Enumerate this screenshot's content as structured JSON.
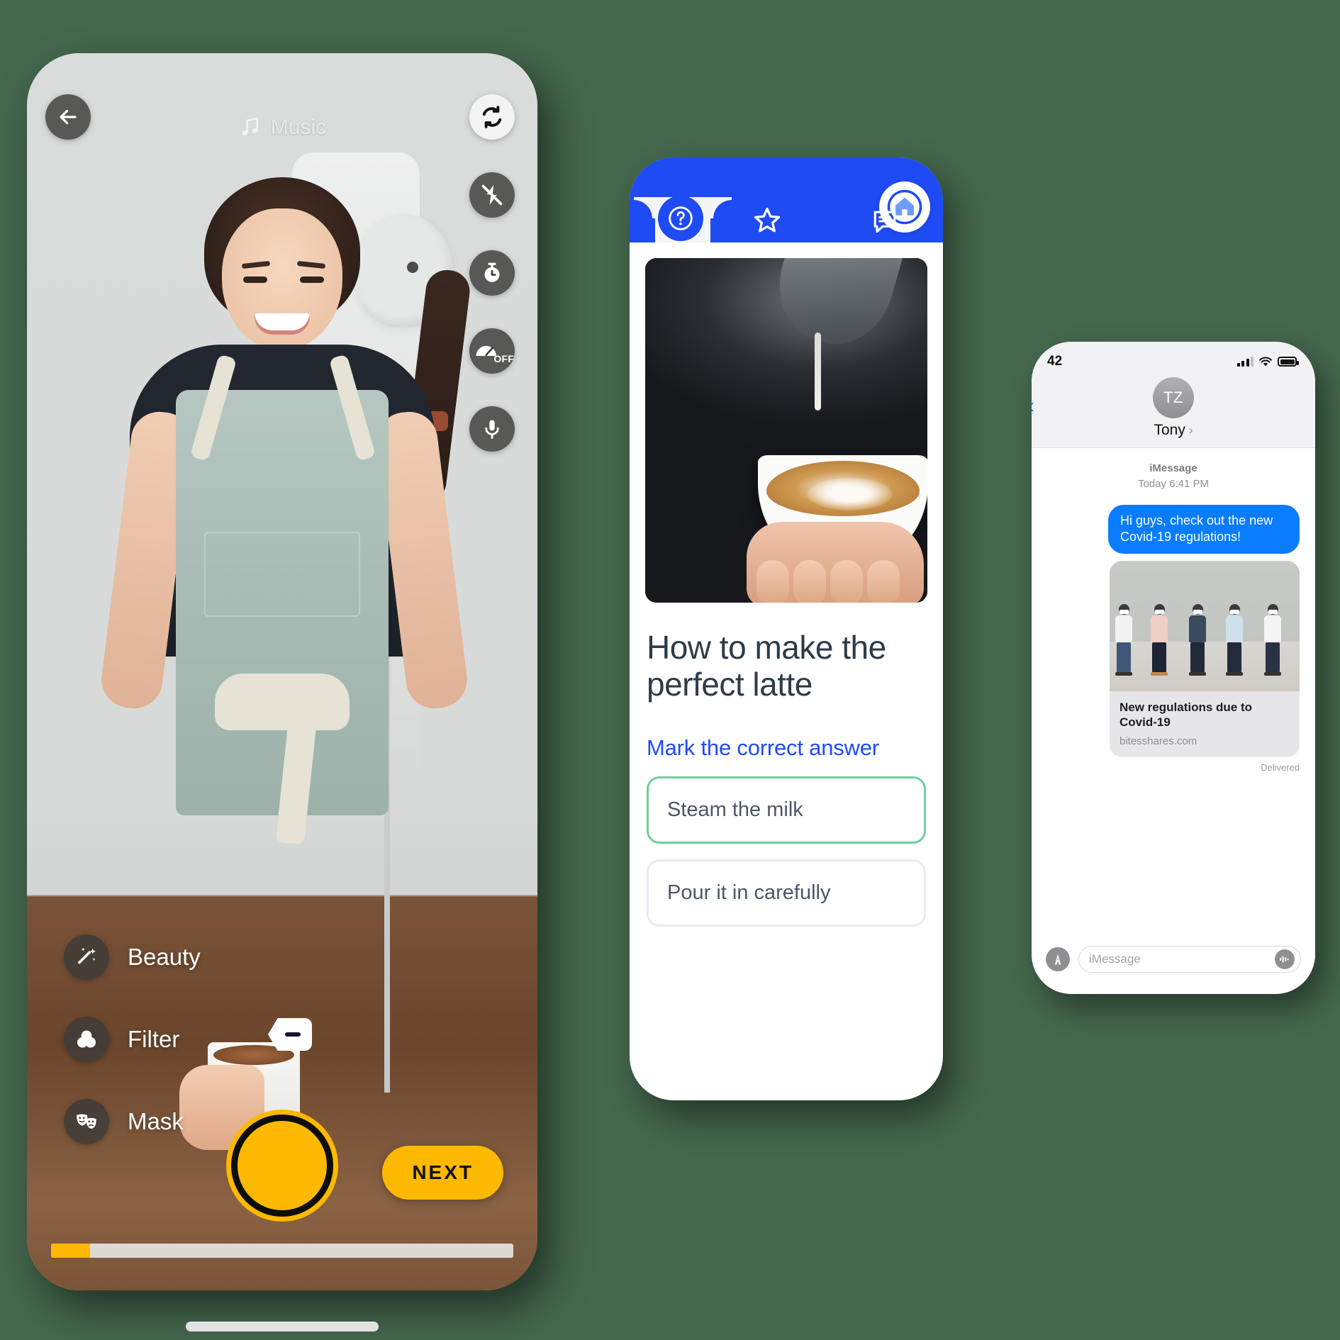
{
  "camera_phone": {
    "music_label": "Music",
    "music_icon": "music-note-icon",
    "back_icon": "arrow-left-icon",
    "right_rail": [
      {
        "name": "flip-camera",
        "icon": "camera-flip-icon",
        "label": "Flip camera"
      },
      {
        "name": "flash",
        "icon": "flash-off-icon",
        "label": "Flash off"
      },
      {
        "name": "timer",
        "icon": "timer-icon",
        "label": "Timer"
      },
      {
        "name": "speed",
        "icon": "speed-off-icon",
        "label": "OFF"
      },
      {
        "name": "microphone",
        "icon": "microphone-icon",
        "label": "Microphone"
      }
    ],
    "speed_badge": "OFF",
    "tools": [
      {
        "label": "Beauty",
        "icon": "magic-wand-icon"
      },
      {
        "label": "Filter",
        "icon": "color-filter-icon"
      },
      {
        "label": "Mask",
        "icon": "theater-masks-icon"
      }
    ],
    "collapse_icon": "collapse-left-icon",
    "shutter": {
      "name": "shutter-button",
      "color": "#fcb900"
    },
    "next_label": "NEXT",
    "progress_percent": 8.5,
    "accent_color": "#fcb900"
  },
  "quiz_phone": {
    "nav": {
      "background": "#1f4bf5",
      "items": [
        {
          "name": "tab-help",
          "icon": "question-circle-icon",
          "active": true
        },
        {
          "name": "tab-favorites",
          "icon": "star-icon",
          "active": false
        },
        {
          "name": "tab-chat",
          "icon": "chat-bubble-icon",
          "active": false
        },
        {
          "name": "tab-home",
          "icon": "home-icon",
          "active": false
        }
      ]
    },
    "hero_image_alt": "Barista pouring steamed milk into a latte",
    "title": "How to make the perfect latte",
    "subtitle": "Mark the correct answer",
    "answers": [
      {
        "text": "Steam the milk",
        "state": "correct",
        "border_color": "#70cf9a"
      },
      {
        "text": "Pour it in carefully",
        "state": "default",
        "border_color": "#e8ecf3"
      }
    ],
    "accent_color": "#1f4bf5"
  },
  "messages_phone": {
    "status_bar": {
      "time": "42",
      "signal_icon": "cellular-bars-icon",
      "wifi_icon": "wifi-icon",
      "battery_icon": "battery-icon"
    },
    "back_icon": "chevron-left-icon",
    "contact": {
      "initials": "TZ",
      "name": "Tony",
      "chevron": "›"
    },
    "conversation_meta": {
      "service": "iMessage",
      "timestamp": "Today 6:41 PM"
    },
    "bubble": {
      "text": "Hi guys, check out the new Covid-19 regulations!",
      "color": "#0a7cff"
    },
    "link_preview": {
      "title": "New regulations due to Covid-19",
      "url": "bitesshares.com",
      "image_alt": "People standing in a socially distanced line wearing face masks"
    },
    "delivery_status": "Delivered",
    "input": {
      "placeholder": "iMessage",
      "left_icon": "app-store-icon",
      "right_icon": "audio-wave-icon"
    }
  }
}
